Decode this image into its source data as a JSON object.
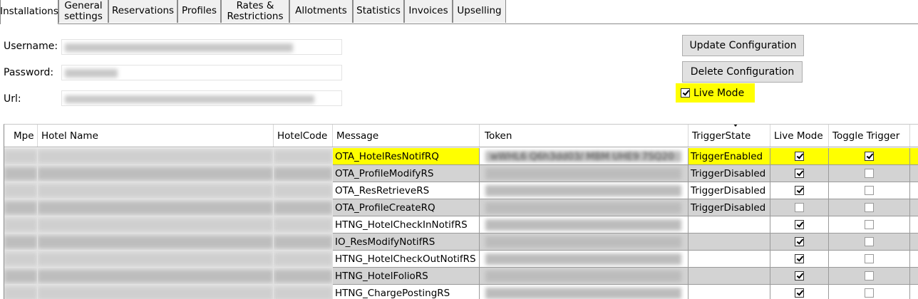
{
  "tabs": [
    {
      "label": "Installations",
      "active": true
    },
    {
      "label": "General\nsettings",
      "active": false
    },
    {
      "label": "Reservations",
      "active": false
    },
    {
      "label": "Profiles",
      "active": false
    },
    {
      "label": "Rates &\nRestrictions",
      "active": false
    },
    {
      "label": "Allotments",
      "active": false
    },
    {
      "label": "Statistics",
      "active": false
    },
    {
      "label": "Invoices",
      "active": false
    },
    {
      "label": "Upselling",
      "active": false
    }
  ],
  "form": {
    "username_label": "Username:",
    "password_label": "Password:",
    "url_label": "Url:"
  },
  "buttons": {
    "update": "Update Configuration",
    "delete": "Delete Configuration"
  },
  "live_mode": {
    "label": "Live Mode",
    "checked": true
  },
  "grid": {
    "columns": [
      "Mpe",
      "Hotel Name",
      "HotelCode",
      "Message",
      "Token",
      "TriggerState",
      "Live Mode",
      "Toggle Trigger"
    ],
    "rows": [
      {
        "message": "OTA_HotelResNotifRQ",
        "token_fragment": "wWHL6 Q6h3dd03/ MBM UHE9 7SQ20",
        "trigger_state": "TriggerEnabled",
        "live": true,
        "toggle": true
      },
      {
        "message": "OTA_ProfileModifyRS",
        "trigger_state": "TriggerDisabled",
        "live": true,
        "toggle": false
      },
      {
        "message": "OTA_ResRetrieveRS",
        "trigger_state": "TriggerDisabled",
        "live": true,
        "toggle": false
      },
      {
        "message": "OTA_ProfileCreateRQ",
        "trigger_state": "TriggerDisabled",
        "live": false,
        "toggle": false
      },
      {
        "message": "HTNG_HotelCheckInNotifRS",
        "trigger_state": "",
        "live": true,
        "toggle": false
      },
      {
        "message": "IO_ResModifyNotifRS",
        "trigger_state": "",
        "live": true,
        "toggle": false
      },
      {
        "message": "HTNG_HotelCheckOutNotifRS",
        "trigger_state": "",
        "live": true,
        "toggle": false
      },
      {
        "message": "HTNG_HotelFolioRS",
        "trigger_state": "",
        "live": true,
        "toggle": false
      },
      {
        "message": "HTNG_ChargePostingRS",
        "trigger_state": "",
        "live": true,
        "toggle": false
      }
    ]
  },
  "colors": {
    "highlight": "#ffff00",
    "row_gray": "#d3d3d3"
  }
}
